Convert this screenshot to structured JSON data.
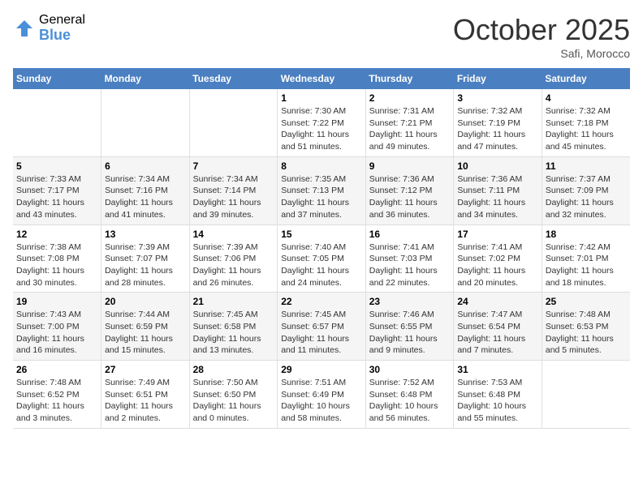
{
  "header": {
    "logo_general": "General",
    "logo_blue": "Blue",
    "month": "October 2025",
    "location": "Safi, Morocco"
  },
  "days_of_week": [
    "Sunday",
    "Monday",
    "Tuesday",
    "Wednesday",
    "Thursday",
    "Friday",
    "Saturday"
  ],
  "weeks": [
    [
      {
        "num": "",
        "info": ""
      },
      {
        "num": "",
        "info": ""
      },
      {
        "num": "",
        "info": ""
      },
      {
        "num": "1",
        "sunrise": "Sunrise: 7:30 AM",
        "sunset": "Sunset: 7:22 PM",
        "daylight": "Daylight: 11 hours and 51 minutes."
      },
      {
        "num": "2",
        "sunrise": "Sunrise: 7:31 AM",
        "sunset": "Sunset: 7:21 PM",
        "daylight": "Daylight: 11 hours and 49 minutes."
      },
      {
        "num": "3",
        "sunrise": "Sunrise: 7:32 AM",
        "sunset": "Sunset: 7:19 PM",
        "daylight": "Daylight: 11 hours and 47 minutes."
      },
      {
        "num": "4",
        "sunrise": "Sunrise: 7:32 AM",
        "sunset": "Sunset: 7:18 PM",
        "daylight": "Daylight: 11 hours and 45 minutes."
      }
    ],
    [
      {
        "num": "5",
        "sunrise": "Sunrise: 7:33 AM",
        "sunset": "Sunset: 7:17 PM",
        "daylight": "Daylight: 11 hours and 43 minutes."
      },
      {
        "num": "6",
        "sunrise": "Sunrise: 7:34 AM",
        "sunset": "Sunset: 7:16 PM",
        "daylight": "Daylight: 11 hours and 41 minutes."
      },
      {
        "num": "7",
        "sunrise": "Sunrise: 7:34 AM",
        "sunset": "Sunset: 7:14 PM",
        "daylight": "Daylight: 11 hours and 39 minutes."
      },
      {
        "num": "8",
        "sunrise": "Sunrise: 7:35 AM",
        "sunset": "Sunset: 7:13 PM",
        "daylight": "Daylight: 11 hours and 37 minutes."
      },
      {
        "num": "9",
        "sunrise": "Sunrise: 7:36 AM",
        "sunset": "Sunset: 7:12 PM",
        "daylight": "Daylight: 11 hours and 36 minutes."
      },
      {
        "num": "10",
        "sunrise": "Sunrise: 7:36 AM",
        "sunset": "Sunset: 7:11 PM",
        "daylight": "Daylight: 11 hours and 34 minutes."
      },
      {
        "num": "11",
        "sunrise": "Sunrise: 7:37 AM",
        "sunset": "Sunset: 7:09 PM",
        "daylight": "Daylight: 11 hours and 32 minutes."
      }
    ],
    [
      {
        "num": "12",
        "sunrise": "Sunrise: 7:38 AM",
        "sunset": "Sunset: 7:08 PM",
        "daylight": "Daylight: 11 hours and 30 minutes."
      },
      {
        "num": "13",
        "sunrise": "Sunrise: 7:39 AM",
        "sunset": "Sunset: 7:07 PM",
        "daylight": "Daylight: 11 hours and 28 minutes."
      },
      {
        "num": "14",
        "sunrise": "Sunrise: 7:39 AM",
        "sunset": "Sunset: 7:06 PM",
        "daylight": "Daylight: 11 hours and 26 minutes."
      },
      {
        "num": "15",
        "sunrise": "Sunrise: 7:40 AM",
        "sunset": "Sunset: 7:05 PM",
        "daylight": "Daylight: 11 hours and 24 minutes."
      },
      {
        "num": "16",
        "sunrise": "Sunrise: 7:41 AM",
        "sunset": "Sunset: 7:03 PM",
        "daylight": "Daylight: 11 hours and 22 minutes."
      },
      {
        "num": "17",
        "sunrise": "Sunrise: 7:41 AM",
        "sunset": "Sunset: 7:02 PM",
        "daylight": "Daylight: 11 hours and 20 minutes."
      },
      {
        "num": "18",
        "sunrise": "Sunrise: 7:42 AM",
        "sunset": "Sunset: 7:01 PM",
        "daylight": "Daylight: 11 hours and 18 minutes."
      }
    ],
    [
      {
        "num": "19",
        "sunrise": "Sunrise: 7:43 AM",
        "sunset": "Sunset: 7:00 PM",
        "daylight": "Daylight: 11 hours and 16 minutes."
      },
      {
        "num": "20",
        "sunrise": "Sunrise: 7:44 AM",
        "sunset": "Sunset: 6:59 PM",
        "daylight": "Daylight: 11 hours and 15 minutes."
      },
      {
        "num": "21",
        "sunrise": "Sunrise: 7:45 AM",
        "sunset": "Sunset: 6:58 PM",
        "daylight": "Daylight: 11 hours and 13 minutes."
      },
      {
        "num": "22",
        "sunrise": "Sunrise: 7:45 AM",
        "sunset": "Sunset: 6:57 PM",
        "daylight": "Daylight: 11 hours and 11 minutes."
      },
      {
        "num": "23",
        "sunrise": "Sunrise: 7:46 AM",
        "sunset": "Sunset: 6:55 PM",
        "daylight": "Daylight: 11 hours and 9 minutes."
      },
      {
        "num": "24",
        "sunrise": "Sunrise: 7:47 AM",
        "sunset": "Sunset: 6:54 PM",
        "daylight": "Daylight: 11 hours and 7 minutes."
      },
      {
        "num": "25",
        "sunrise": "Sunrise: 7:48 AM",
        "sunset": "Sunset: 6:53 PM",
        "daylight": "Daylight: 11 hours and 5 minutes."
      }
    ],
    [
      {
        "num": "26",
        "sunrise": "Sunrise: 7:48 AM",
        "sunset": "Sunset: 6:52 PM",
        "daylight": "Daylight: 11 hours and 3 minutes."
      },
      {
        "num": "27",
        "sunrise": "Sunrise: 7:49 AM",
        "sunset": "Sunset: 6:51 PM",
        "daylight": "Daylight: 11 hours and 2 minutes."
      },
      {
        "num": "28",
        "sunrise": "Sunrise: 7:50 AM",
        "sunset": "Sunset: 6:50 PM",
        "daylight": "Daylight: 11 hours and 0 minutes."
      },
      {
        "num": "29",
        "sunrise": "Sunrise: 7:51 AM",
        "sunset": "Sunset: 6:49 PM",
        "daylight": "Daylight: 10 hours and 58 minutes."
      },
      {
        "num": "30",
        "sunrise": "Sunrise: 7:52 AM",
        "sunset": "Sunset: 6:48 PM",
        "daylight": "Daylight: 10 hours and 56 minutes."
      },
      {
        "num": "31",
        "sunrise": "Sunrise: 7:53 AM",
        "sunset": "Sunset: 6:48 PM",
        "daylight": "Daylight: 10 hours and 55 minutes."
      },
      {
        "num": "",
        "info": ""
      }
    ]
  ]
}
